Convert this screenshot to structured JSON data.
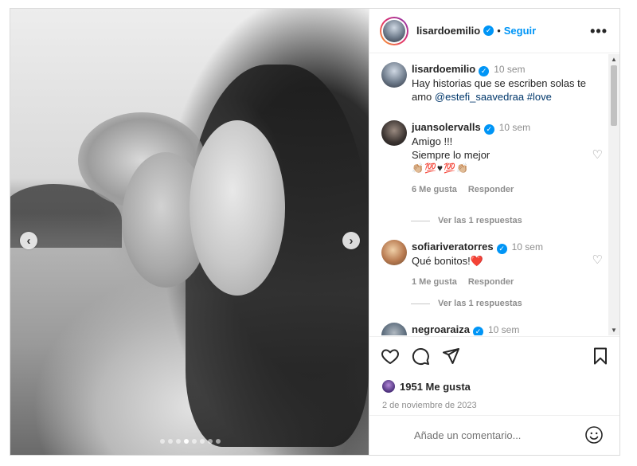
{
  "post": {
    "author": "lisardoemilio",
    "follow_label": "Seguir",
    "separator": "•",
    "more_label": "•••",
    "nav_prev": "‹",
    "nav_next": "›",
    "carousel": {
      "count": 8,
      "active_index": 3
    }
  },
  "caption": {
    "user": "lisardoemilio",
    "time": "10 sem",
    "text": "Hay historias que se escriben solas te amo ",
    "mention": "@estefi_saavedraa",
    "hashtag": "#love"
  },
  "comments": [
    {
      "user": "juansolervalls",
      "time": "10 sem",
      "line1": "Amigo !!!",
      "line2": "Siempre lo mejor",
      "emoji": "👏🏼💯♥💯👏🏼",
      "likes": "6 Me gusta",
      "reply_label": "Responder",
      "replies_label": "Ver las 1 respuestas"
    },
    {
      "user": "sofiariveratorres",
      "time": "10 sem",
      "line1": "Qué bonitos!❤️",
      "likes": "1 Me gusta",
      "reply_label": "Responder",
      "replies_label": "Ver las 1 respuestas"
    },
    {
      "user": "negroaraiza",
      "time": "10 sem",
      "emoji": "👏👏👏"
    }
  ],
  "actions": {
    "likes_count": "1951 Me gusta",
    "date": "2 de noviembre de 2023"
  },
  "composer": {
    "placeholder": "Añade un comentario..."
  },
  "icons": {
    "verified": "verified-badge-icon",
    "like": "heart-icon",
    "comment": "comment-bubble-icon",
    "share": "paper-plane-icon",
    "save": "bookmark-icon",
    "emoji": "smiley-icon"
  },
  "colors": {
    "accent": "#0095f6",
    "muted": "#8e8e8e",
    "text": "#262626"
  }
}
